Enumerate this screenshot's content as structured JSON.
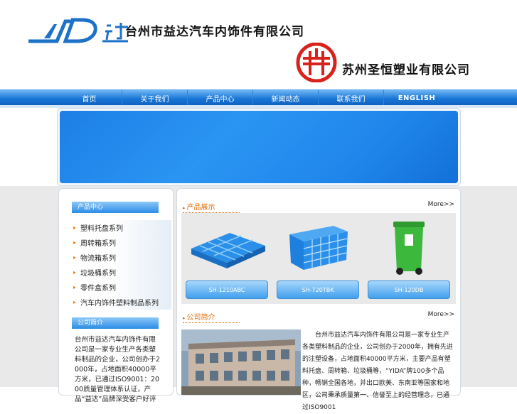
{
  "header": {
    "logo1_text": "YD达",
    "company1": "台州市益达汽车内饰件有限公司",
    "company2": "苏州圣恒塑业有限公司"
  },
  "nav": {
    "items": [
      "首页",
      "关于我们",
      "产品中心",
      "新闻动态",
      "联系我们",
      "ENGLISH"
    ]
  },
  "sidebar": {
    "products_heading": "产品中心",
    "categories": [
      "塑料托盘系列",
      "周转箱系列",
      "物流箱系列",
      "垃圾桶系列",
      "零件盒系列",
      "汽车内饰件塑料制品系列"
    ],
    "about_heading": "公司简介",
    "about_text": "台州市益达汽车内饰件有限公司是一家专业生产各类塑料制品的企业，公司创办于2000年，占地面积40000平方米，已通过ISO9001：2000质量管理体系认证，产品“益达”品牌深受客户好评"
  },
  "main": {
    "products_title": "产品展示",
    "products_more": "More>>",
    "products": [
      {
        "label": "SH-1210ABC"
      },
      {
        "label": "SH-720TBK"
      },
      {
        "label": "SH-120DB"
      }
    ],
    "about_title": "公司简介",
    "about_more": "More>>",
    "about_text": "台州市益达汽车内饰件有限公司是一家专业生产各类塑料制品的企业，公司创办于2000年，拥有先进的注塑设备，占地面积40000平方米，主要产品有塑料托盘、周转箱、垃圾桶等，“YIDA”牌100多个品种，畅销全国各地，并出口欧美、东南亚等国家和地区，公司秉承质量第一、信誉至上的经营理念，已通过ISO9001"
  },
  "colors": {
    "nav_blue": "#1976d6",
    "accent_orange": "#e26a00",
    "banner_blue": "#2a95f2"
  }
}
